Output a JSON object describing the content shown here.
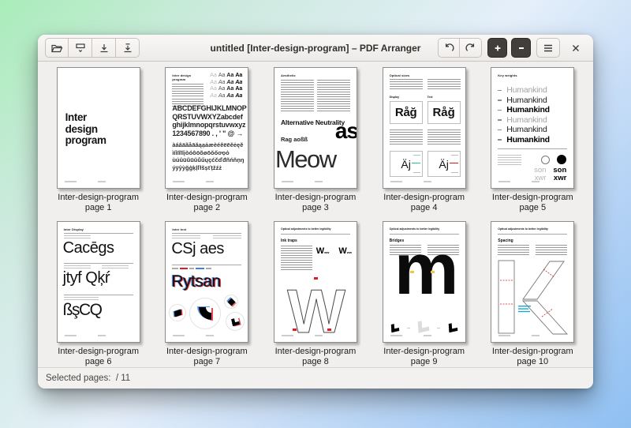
{
  "window": {
    "title": "untitled [Inter-design-program] – PDF Arranger",
    "status_text": "Selected pages:  / 11"
  },
  "colors": {
    "accent_red": "#e01b24",
    "accent_blue": "#3584e4",
    "accent_cyan": "#1fa7c9",
    "accent_green": "#2ec27e",
    "accent_yellow": "#f6c445",
    "background_green": "#a9edb9",
    "background_blue": "#8fc0f2"
  },
  "pages": [
    {
      "caption": "Inter-design-program",
      "page": "page 1",
      "line1": "Inter",
      "line2": "design",
      "line3": "program"
    },
    {
      "caption": "Inter-design-program",
      "page": "page 2",
      "header": "Inter design program",
      "aa": "Aa",
      "alpha1": "ABCDEFGHIJKLMNOP",
      "alpha2": "QRSTUVWXYZabcdef",
      "alpha3": "ghijklmnopqrstuvwxyz",
      "alpha4": "1234567890 . , ' \" @ →",
      "acc1": "àáâäãåāăąạảæèéêëēĕėęě",
      "acc2": "ìíîïĩīĭįòóôöõøōŏőơọỏ",
      "acc3": "ùúûüũūŭůűųçćčďđñńňņŋ",
      "acc4": "ýÿŷỳğģķļľłšșťțžźż"
    },
    {
      "caption": "Inter-design-program",
      "page": "page 3",
      "header": "Aesthetic",
      "heading": "Alternative Neutrality",
      "sub": "Rag aoßß",
      "big": "as",
      "giant": "Meow"
    },
    {
      "caption": "Inter-design-program",
      "page": "page 4",
      "header": "Optical sizes",
      "label_left": "Display",
      "label_right": "Text",
      "sample": "Råğ",
      "sample2": "Äj"
    },
    {
      "caption": "Inter-design-program",
      "page": "page 5",
      "header": "Key weights",
      "word": "Humankind",
      "o": "O",
      "son": "son",
      "xwr": "xwr"
    },
    {
      "caption": "Inter-design-program",
      "page": "page 6",
      "header": "Inter Display",
      "row1": "Cacēgs",
      "row2": "jtyf Qķŕ",
      "row3": "ßşCQ"
    },
    {
      "caption": "Inter-design-program",
      "page": "page 7",
      "header": "Inter text",
      "row1": "CSj aes",
      "row2": "Rytsan"
    },
    {
      "caption": "Inter-design-program",
      "page": "page 8",
      "header": "Optical adjustments to better legibility",
      "subhead": "Ink traps",
      "w": "W",
      "w_small": "ww",
      "giant": "W"
    },
    {
      "caption": "Inter-design-program",
      "page": "page 9",
      "header": "Optical adjustments to better legibility",
      "subhead": "Bridges",
      "giant": "m"
    },
    {
      "caption": "Inter-design-program",
      "page": "page 10",
      "header": "Optical adjustments to better legibility",
      "subhead": "Spacing",
      "giant": "K"
    }
  ]
}
